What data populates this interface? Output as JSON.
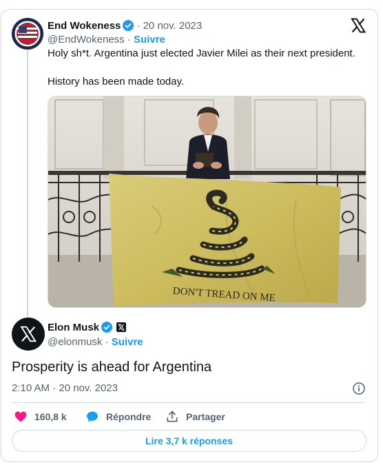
{
  "tweet": {
    "author": "End Wokeness",
    "date": "20 nov. 2023",
    "handle": "@EndWokeness",
    "follow_label": "Suivre",
    "text_line1": "Holy sh*t. Argentina just elected Javier Milei as their next president.",
    "text_line2": "History has been made today.",
    "flag_text": "DON'T TREAD ON ME"
  },
  "reply": {
    "author": "Elon Musk",
    "handle": "@elonmusk",
    "follow_label": "Suivre",
    "text": "Prosperity is ahead for Argentina",
    "timestamp": "2:10 AM · 20 nov. 2023",
    "likes": "160,8 k",
    "reply_label": "Répondre",
    "share_label": "Partager",
    "more_replies_label": "Lire 3,7 k réponses"
  },
  "colors": {
    "accent": "#1d9bf0",
    "like": "#f91880",
    "text": "#0f1419",
    "muted": "#536471",
    "border": "#cfd9de"
  },
  "icons": [
    "verified-badge-icon",
    "x-logo-icon",
    "heart-icon",
    "reply-bubble-icon",
    "share-icon",
    "info-icon"
  ]
}
